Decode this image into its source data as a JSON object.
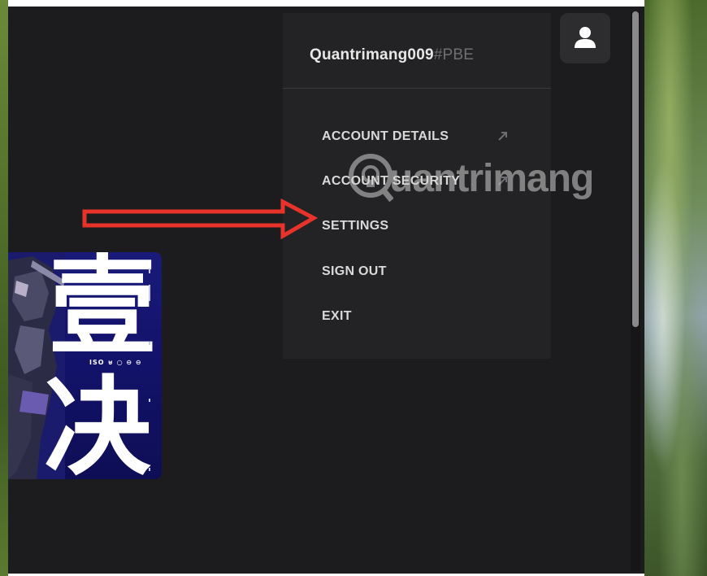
{
  "account": {
    "username": "Quantrimang009",
    "tag": "#PBE"
  },
  "menu": {
    "items": [
      {
        "label": "ACCOUNT DETAILS",
        "external": true
      },
      {
        "label": "ACCOUNT SECURITY",
        "external": true
      },
      {
        "label": "SETTINGS",
        "external": false
      },
      {
        "label": "SIGN OUT",
        "external": false
      },
      {
        "label": "EXIT",
        "external": false
      }
    ]
  },
  "card": {
    "glyph_top": "壹",
    "glyph_bottom": "决",
    "small_text": "ISO ⊍ ○ ⊖ ⊖"
  },
  "watermark": {
    "text": "uantrimang"
  },
  "colors": {
    "app_bg": "#1c1c1e",
    "menu_bg": "#232325",
    "annotation_arrow": "#e8332a",
    "card_bg": "#12126a"
  }
}
